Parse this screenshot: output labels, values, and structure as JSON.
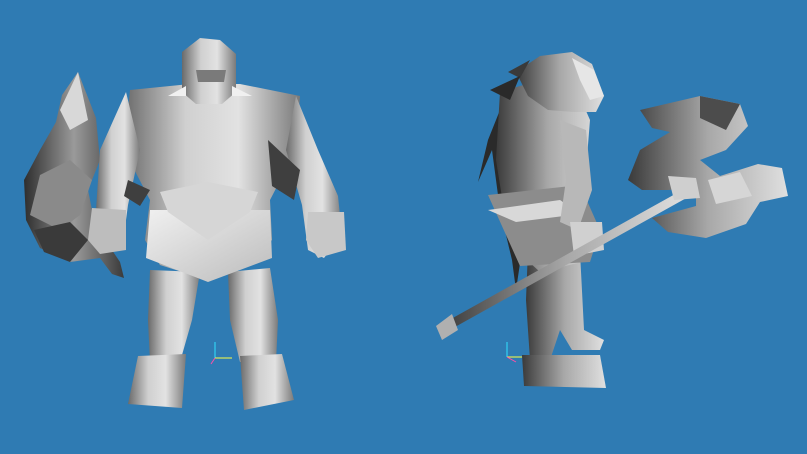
{
  "scene": {
    "background_color": "#2f7bb3",
    "model_shade_light": "#e6e6e6",
    "model_shade_mid": "#b4b4b4",
    "model_shade_dark": "#4a4a4a",
    "views": [
      {
        "name": "front-view",
        "subject": "orc-warrior-model"
      },
      {
        "name": "side-view",
        "subject": "orc-warrior-model"
      }
    ],
    "axis_gizmo_colors": {
      "x": "#ff4fa8",
      "y": "#30e0ff",
      "z": "#ffff40"
    }
  }
}
